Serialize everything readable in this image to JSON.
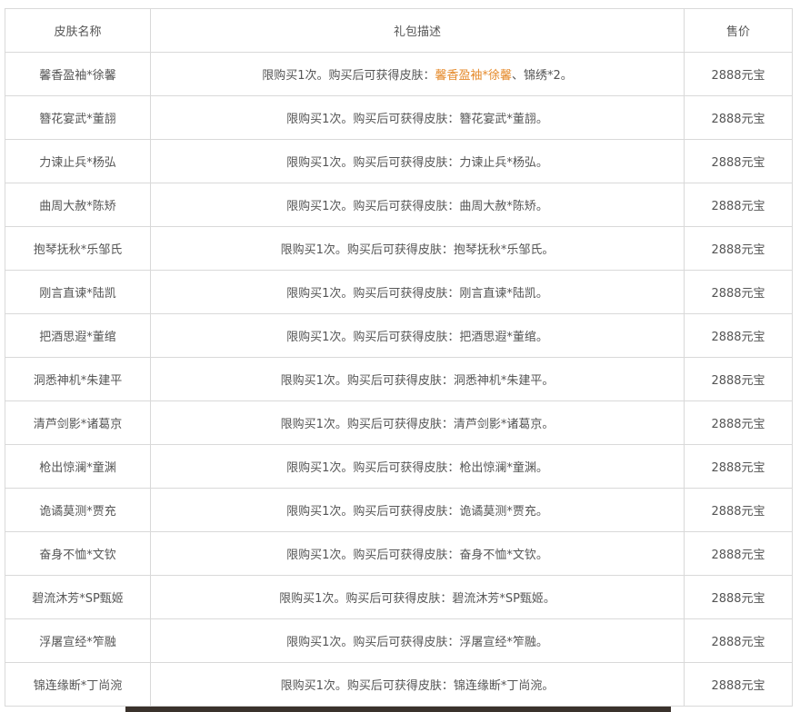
{
  "table": {
    "headers": [
      "皮肤名称",
      "礼包描述",
      "售价"
    ],
    "first_row": {
      "name": "馨香盈袖*徐馨",
      "desc_prefix": "限购买1次。购买后可获得皮肤：",
      "desc_highlight": "馨香盈袖*徐馨",
      "desc_suffix": "、锦绣*2。",
      "price": "2888元宝"
    },
    "rows": [
      {
        "name": "簪花宴武*董翓",
        "desc": "限购买1次。购买后可获得皮肤：簪花宴武*董翓。",
        "price": "2888元宝"
      },
      {
        "name": "力谏止兵*杨弘",
        "desc": "限购买1次。购买后可获得皮肤：力谏止兵*杨弘。",
        "price": "2888元宝"
      },
      {
        "name": "曲周大赦*陈矫",
        "desc": "限购买1次。购买后可获得皮肤：曲周大赦*陈矫。",
        "price": "2888元宝"
      },
      {
        "name": "抱琴抚秋*乐邹氏",
        "desc": "限购买1次。购买后可获得皮肤：抱琴抚秋*乐邹氏。",
        "price": "2888元宝"
      },
      {
        "name": "刚言直谏*陆凯",
        "desc": "限购买1次。购买后可获得皮肤：刚言直谏*陆凯。",
        "price": "2888元宝"
      },
      {
        "name": "把酒思遐*董绾",
        "desc": "限购买1次。购买后可获得皮肤：把酒思遐*董绾。",
        "price": "2888元宝"
      },
      {
        "name": "洞悉神机*朱建平",
        "desc": "限购买1次。购买后可获得皮肤：洞悉神机*朱建平。",
        "price": "2888元宝"
      },
      {
        "name": "清芦剑影*诸葛京",
        "desc": "限购买1次。购买后可获得皮肤：清芦剑影*诸葛京。",
        "price": "2888元宝"
      },
      {
        "name": "枪出惊澜*童渊",
        "desc": "限购买1次。购买后可获得皮肤：枪出惊澜*童渊。",
        "price": "2888元宝"
      },
      {
        "name": "诡谲莫测*贾充",
        "desc": "限购买1次。购买后可获得皮肤：诡谲莫测*贾充。",
        "price": "2888元宝"
      },
      {
        "name": "奋身不恤*文钦",
        "desc": "限购买1次。购买后可获得皮肤：奋身不恤*文钦。",
        "price": "2888元宝"
      },
      {
        "name": "碧流沐芳*SP甄姬",
        "desc": "限购买1次。购买后可获得皮肤：碧流沐芳*SP甄姬。",
        "price": "2888元宝"
      },
      {
        "name": "浮屠宣经*笮融",
        "desc": "限购买1次。购买后可获得皮肤：浮屠宣经*笮融。",
        "price": "2888元宝"
      },
      {
        "name": "锦连缘断*丁尚涴",
        "desc": "限购买1次。购买后可获得皮肤：锦连缘断*丁尚涴。",
        "price": "2888元宝"
      }
    ]
  },
  "colors": {
    "highlight": "#e58a2b",
    "border": "#d9d9d9",
    "text": "#555555"
  }
}
